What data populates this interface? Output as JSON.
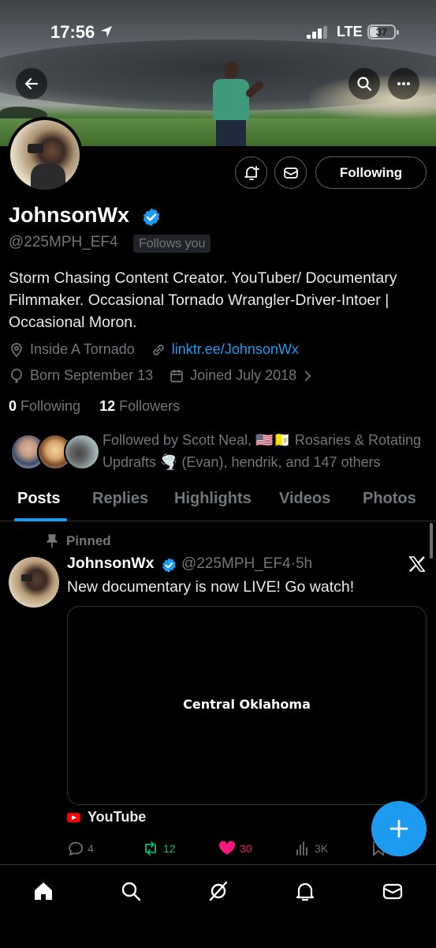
{
  "status_bar": {
    "time": "17:56",
    "network": "LTE",
    "battery": "37",
    "battery_level_pct": 37
  },
  "profile": {
    "name": "JohnsonWx",
    "handle": "@225MPH_EF4",
    "follows_you": "Follows you",
    "bio": "Storm Chasing Content Creator. YouTuber/ Documentary Filmmaker. Occasional Tornado Wrangler-Driver-Intoer | Occasional Moron.",
    "location": "Inside A Tornado",
    "link": "linktr.ee/JohnsonWx",
    "born": "Born September 13",
    "joined": "Joined July 2018",
    "following_count": "0",
    "following_label": "Following",
    "followers_count": "12",
    "followers_label": "Followers",
    "followed_by": "Followed by Scott Neal, 🇺🇸🇻🇦 Rosaries & Rotating Updrafts 🌪️ (Evan), hendrik, and 147 others",
    "following_button": "Following"
  },
  "tabs": [
    "Posts",
    "Replies",
    "Highlights",
    "Videos",
    "Photos"
  ],
  "post": {
    "pinned_label": "Pinned",
    "author_name": "JohnsonWx",
    "author_handle": "@225MPH_EF4",
    "time": "5h",
    "text": "New documentary is now LIVE! Go watch!",
    "media_title": "Central Oklahoma",
    "source": "YouTube",
    "replies": "4",
    "reposts": "12",
    "likes": "30",
    "views": "3K"
  },
  "colors": {
    "accent": "#1d9bf0",
    "repost": "#00ba7c",
    "like": "#f91880",
    "muted": "#71767b"
  }
}
